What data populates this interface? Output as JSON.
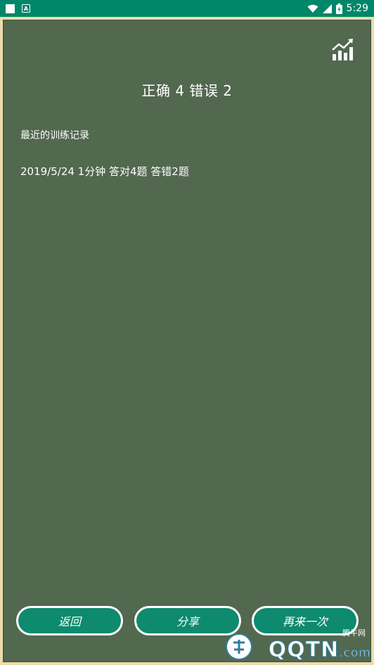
{
  "status_bar": {
    "time": "5:29",
    "notification_icon_letter": "A"
  },
  "result": {
    "title": "正确 4 错误 2"
  },
  "history": {
    "label": "最近的训练记录",
    "records": [
      "2019/5/24 1分钟 答对4题 答错2题"
    ]
  },
  "buttons": {
    "back": "返回",
    "share": "分享",
    "again": "再来一次"
  },
  "watermark": {
    "brand": "QQTN",
    "suffix": ".com",
    "cn": "腾牛网"
  },
  "colors": {
    "status_bar": "#00876a",
    "board": "#52684f",
    "frame": "#ecdcab",
    "button": "#0e8a6e"
  }
}
